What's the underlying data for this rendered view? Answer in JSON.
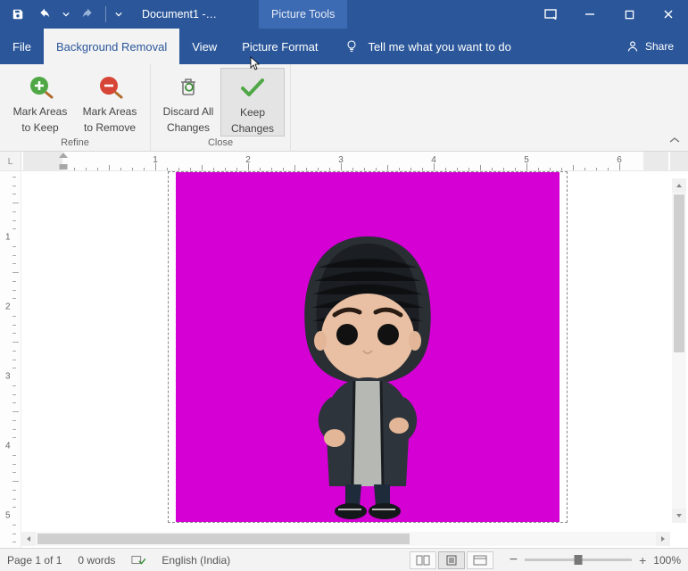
{
  "titlebar": {
    "document_title": "Document1  -…",
    "context_tab": "Picture Tools"
  },
  "tabs": {
    "file": "File",
    "background_removal": "Background Removal",
    "view": "View",
    "picture_format": "Picture Format",
    "tell_me": "Tell me what you want to do",
    "share": "Share"
  },
  "ribbon": {
    "mark_keep_l1": "Mark Areas",
    "mark_keep_l2": "to Keep",
    "mark_remove_l1": "Mark Areas",
    "mark_remove_l2": "to Remove",
    "discard_l1": "Discard All",
    "discard_l2": "Changes",
    "keep_l1": "Keep",
    "keep_l2": "Changes",
    "group_refine": "Refine",
    "group_close": "Close"
  },
  "ruler": {
    "corner": "L"
  },
  "status": {
    "page": "Page 1 of 1",
    "words": "0 words",
    "language": "English (India)",
    "zoom": "100%"
  }
}
